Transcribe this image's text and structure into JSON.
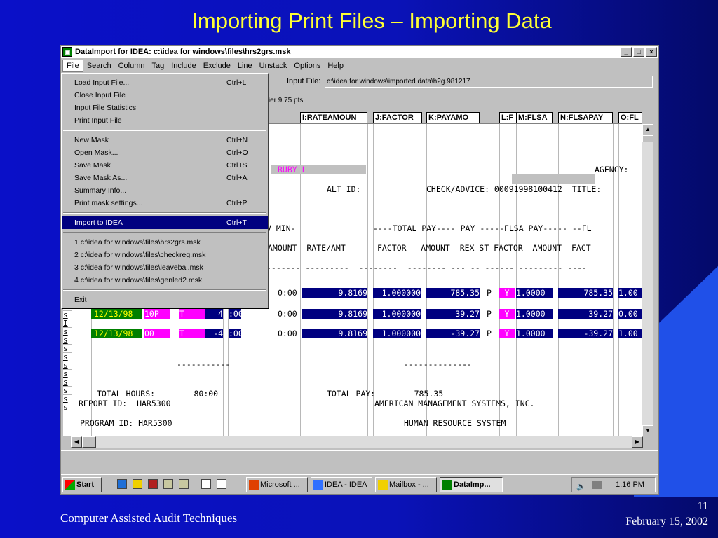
{
  "slide": {
    "title": "Importing Print Files – Importing Data",
    "footer_left": "Computer Assisted Audit Techniques",
    "page_number": "11",
    "date": "February 15, 2002"
  },
  "window": {
    "title": "DataImport for IDEA: c:\\idea for windows\\files\\hrs2grs.msk",
    "buttons": [
      "_",
      "□",
      "×"
    ]
  },
  "menubar": [
    "File",
    "Search",
    "Column",
    "Tag",
    "Include",
    "Exclude",
    "Line",
    "Unstack",
    "Options",
    "Help"
  ],
  "toolbar": {
    "input_file_label": "Input File:",
    "input_file_value": "c:\\idea for windows\\imported data\\h2g.981217",
    "font_label": "urier 9.75 pts"
  },
  "file_menu": {
    "groups": [
      [
        {
          "label": "Load Input File...",
          "shortcut": "Ctrl+L"
        },
        {
          "label": "Close Input File",
          "shortcut": ""
        },
        {
          "label": "Input File Statistics",
          "shortcut": ""
        },
        {
          "label": "Print Input File",
          "shortcut": ""
        }
      ],
      [
        {
          "label": "New Mask",
          "shortcut": "Ctrl+N"
        },
        {
          "label": "Open Mask...",
          "shortcut": "Ctrl+O"
        },
        {
          "label": "Save Mask",
          "shortcut": "Ctrl+S"
        },
        {
          "label": "Save Mask As...",
          "shortcut": "Ctrl+A"
        },
        {
          "label": "Summary Info...",
          "shortcut": ""
        },
        {
          "label": "Print mask settings...",
          "shortcut": "Ctrl+P"
        }
      ],
      [
        {
          "label": "Import to IDEA",
          "shortcut": "Ctrl+T"
        }
      ],
      [
        {
          "label": "1 c:\\idea for windows\\files\\hrs2grs.msk",
          "shortcut": ""
        },
        {
          "label": "2 c:\\idea for windows\\files\\checkreg.msk",
          "shortcut": ""
        },
        {
          "label": "3 c:\\idea for windows\\files\\leavebal.msk",
          "shortcut": ""
        },
        {
          "label": "4 c:\\idea for windows\\files\\genled2.msk",
          "shortcut": ""
        }
      ],
      [
        {
          "label": "Exit",
          "shortcut": ""
        }
      ]
    ]
  },
  "column_headers": [
    "I:RATEAMOUN",
    "J:FACTOR",
    "K:PAYAMO",
    "L:F",
    "M:FLSA",
    "N:FLSAPAY",
    "O:FL"
  ],
  "report": {
    "name_value": "RUBY L",
    "agency_label": "AGENCY:",
    "id_digit": "8",
    "alt_id_label": "ALT ID:",
    "check_label": "CHECK/ADVICE: 00091998100412  TITLE:",
    "header1a": "V MIN-",
    "header1b": "----TOTAL PAY---- PAY -----FLSA PAY----- --FL",
    "header2a": "AMOUNT  RATE/AMT",
    "header2b": "FACTOR   AMOUNT  REX ST FACTOR  AMOUNT  FACT",
    "dashes": "------- ---------  --------  -------- --- -- ------ --------- ----",
    "rows": [
      {
        "date": "",
        "code": "",
        "type": "",
        "hours": "",
        "min": "0:00",
        "rate": "9.8169",
        "factor": "1.000000",
        "amount": "785.35",
        "p": "P",
        "y": "Y",
        "flsa_factor": "1.0000",
        "flsa_amount": "785.35",
        "fact": "1.00"
      },
      {
        "date": "12/13/98",
        "code": "10P",
        "type": "T",
        "hours": "4",
        "min": "0:00",
        "rate": "9.8169",
        "factor": "1.000000",
        "amount": "39.27",
        "p": "P",
        "y": "Y",
        "flsa_factor": "1.0000",
        "flsa_amount": "39.27",
        "fact": "0.00"
      },
      {
        "date": "12/13/98",
        "code": "00",
        "type": "T",
        "hours": "-4",
        "min": "0:00",
        "rate": "9.8169",
        "factor": "1.000000",
        "amount": "-39.27",
        "p": "P",
        "y": "Y",
        "flsa_factor": "1.0000",
        "flsa_amount": "-39.27",
        "fact": "1.00"
      }
    ],
    "underline1": "-----------",
    "underline2": "--------------",
    "total_hours": "TOTAL HOURS:        80:00",
    "total_pay": "TOTAL PAY:        785.35",
    "report_id": "REPORT ID:  HAR5300",
    "company": "AMERICAN MANAGEMENT SYSTEMS, INC.",
    "program_id": "PROGRAM ID: HAR5300",
    "system": "HUMAN RESOURCE SYSTEM",
    "left_letters": [
      "I",
      "s",
      "I",
      "s",
      "s",
      "s",
      "s",
      "s",
      "s",
      "s",
      "s",
      "s",
      "s"
    ]
  },
  "taskbar": {
    "start": "Start",
    "items": [
      "Microsoft ...",
      "IDEA - IDEA",
      "Mailbox - ...",
      "DataImp..."
    ],
    "clock": "1:16 PM"
  }
}
